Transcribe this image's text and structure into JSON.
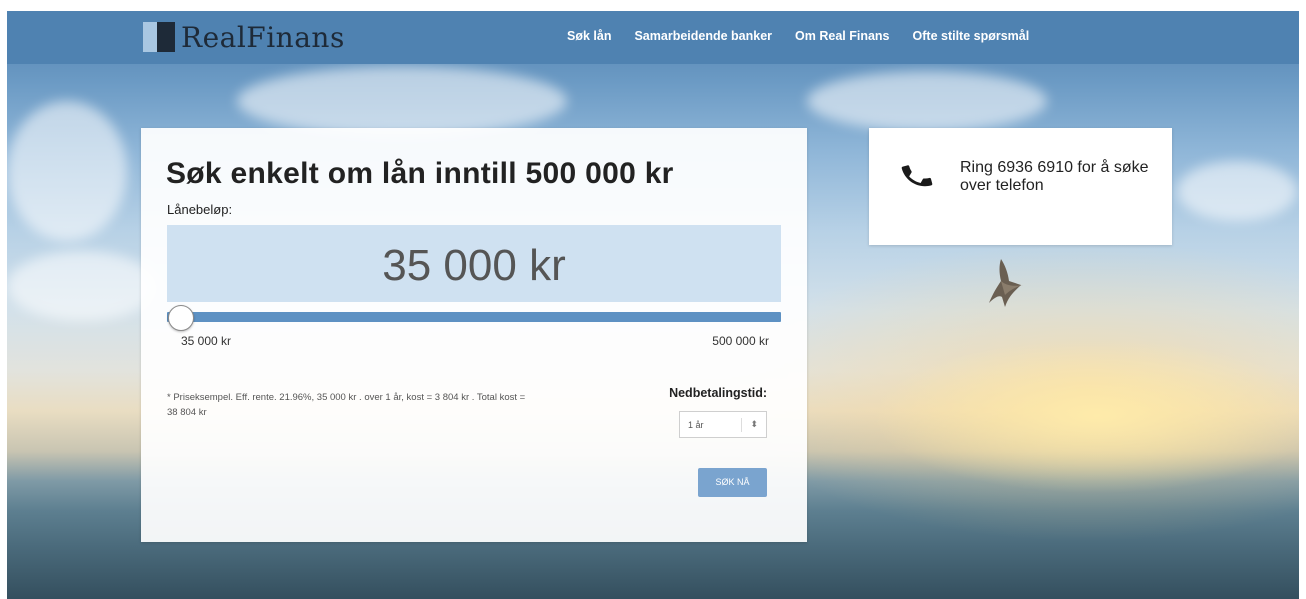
{
  "brand": {
    "name": "RealFinans"
  },
  "nav": {
    "links": [
      {
        "label": "Søk lån"
      },
      {
        "label": "Samarbeidende banker"
      },
      {
        "label": "Om Real Finans"
      },
      {
        "label": "Ofte stilte spørsmål"
      }
    ]
  },
  "loan_form": {
    "headline": "Søk enkelt om lån inntill 500 000 kr",
    "amount_label": "Lånebeløp:",
    "amount_value": "35 000 kr",
    "slider": {
      "min_label": "35 000 kr",
      "max_label": "500 000 kr",
      "position_fraction": 0.0
    },
    "disclaimer": "* Priseksempel. Eff. rente. 21.96%, 35 000 kr . over 1 år, kost = 3 804 kr . Total kost = 38 804 kr",
    "term_label": "Nedbetalingstid:",
    "term_value": "1 år",
    "submit_label": "SØK NÅ"
  },
  "phone_card": {
    "text": "Ring 6936 6910 for å søke over telefon"
  },
  "colors": {
    "nav_bg": "#4f82b1",
    "amount_bg": "#cfe1f1",
    "slider_track": "#5d91c3",
    "button_bg": "#7aa4cf"
  },
  "icons": {
    "phone": "phone-icon",
    "logo": "logo-icon"
  }
}
